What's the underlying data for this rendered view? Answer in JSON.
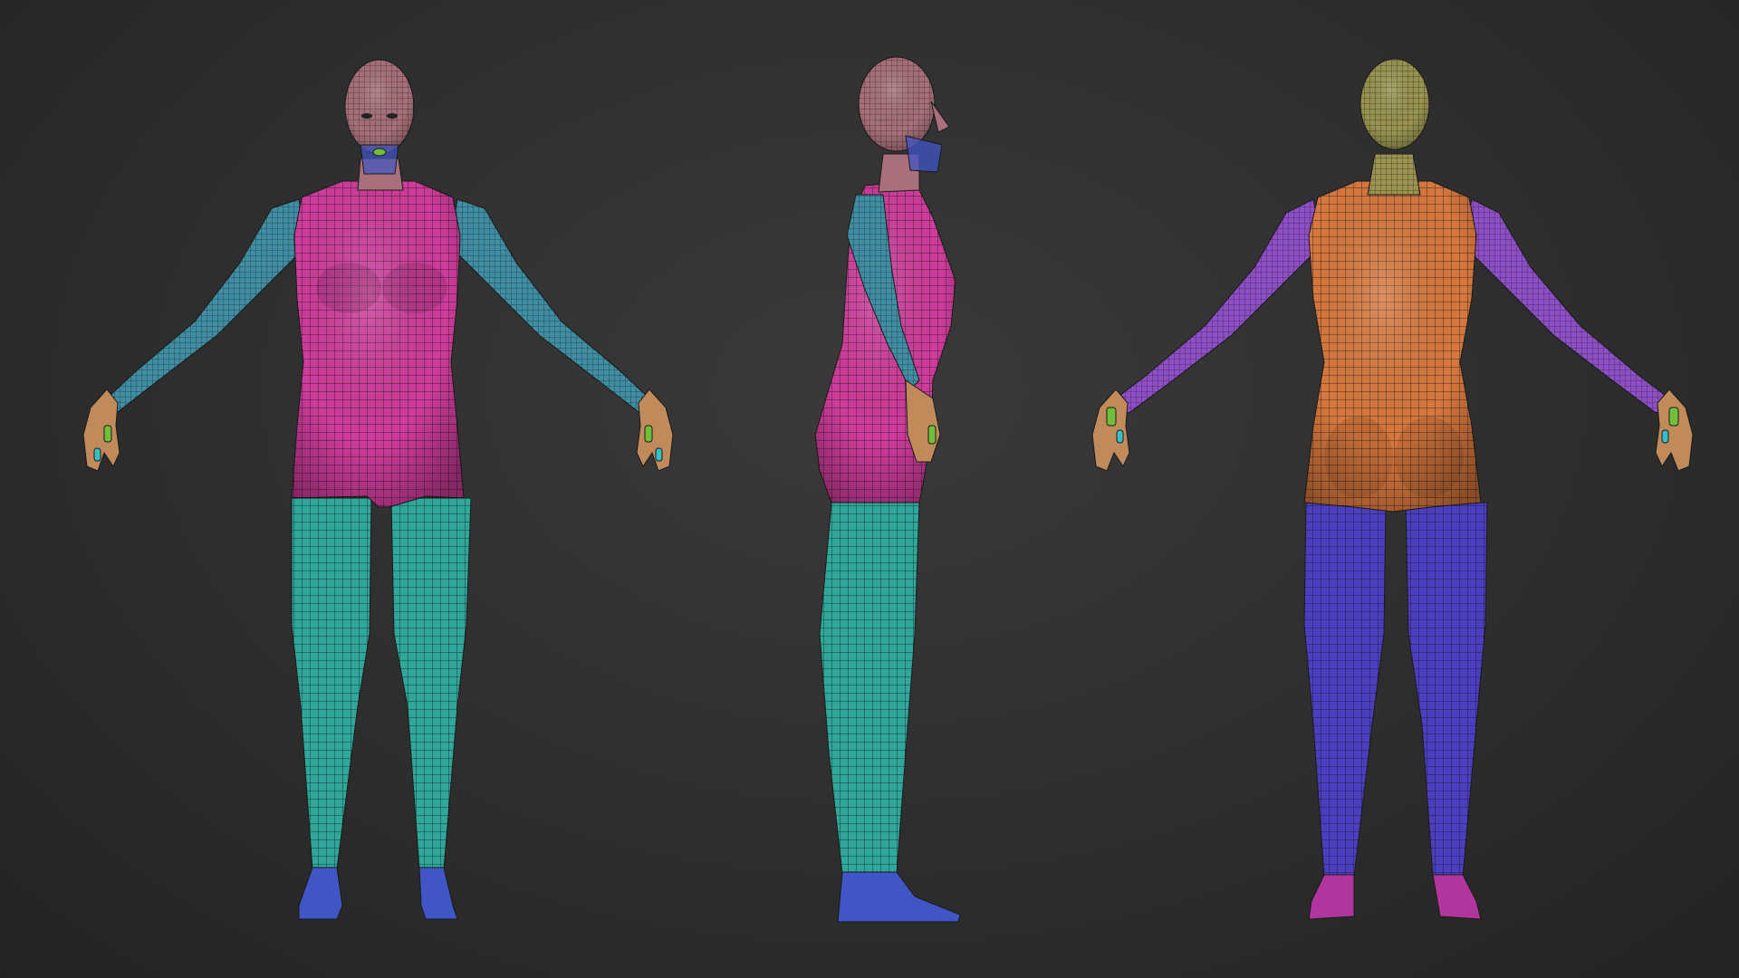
{
  "scene": {
    "background_color": "#2e2e2e",
    "views": [
      {
        "name": "front",
        "label_visible": false
      },
      {
        "name": "side",
        "label_visible": false
      },
      {
        "name": "back",
        "label_visible": false
      }
    ],
    "polygroup_colors": {
      "front_torso": "#cf3c9c",
      "front_arms": "#3f8ea3",
      "front_legs": "#2fa79a",
      "front_feet": "#3f56c4",
      "head": "#a8707a",
      "back_torso": "#d8783e",
      "back_arms": "#8e4fc6",
      "back_legs": "#4b3fbf",
      "back_head": "#9a9450",
      "back_feet": "#b0359c",
      "hands": "#c08a5a",
      "fingers_green": "#6fbf3a",
      "fingers_cyan": "#35c0c8",
      "wireframe": "#1a1a1a"
    }
  }
}
